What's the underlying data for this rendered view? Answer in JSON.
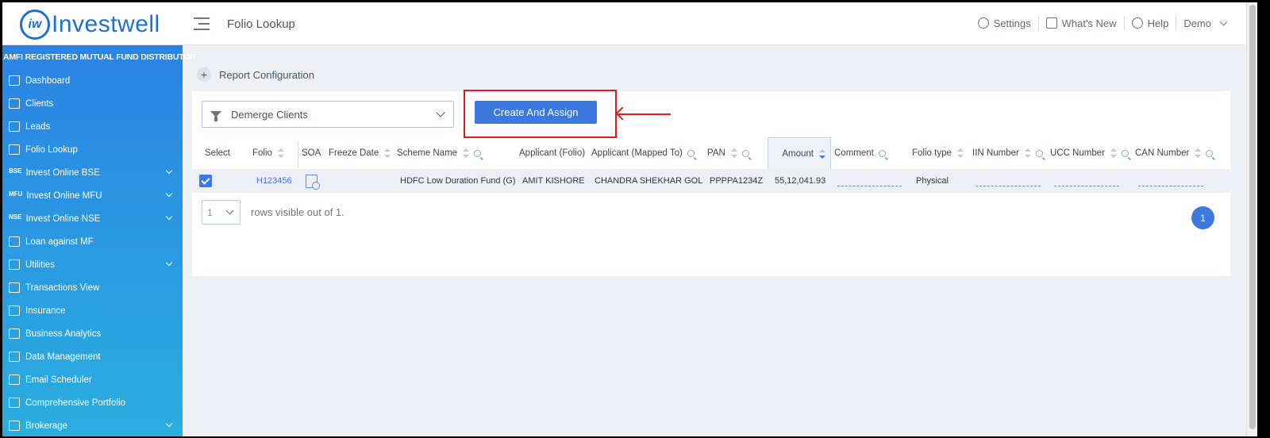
{
  "app": {
    "logo_mark": "iw",
    "logo_text": "Investwell"
  },
  "header": {
    "page_title": "Folio Lookup",
    "settings": "Settings",
    "whats_new": "What's New",
    "help": "Help",
    "user": "Demo"
  },
  "sidebar": {
    "amfi": "AMFI REGISTERED MUTUAL FUND DISTRIBUTOR",
    "items": [
      {
        "label": "Dashboard",
        "icon": "home-icon",
        "chevron": false
      },
      {
        "label": "Clients",
        "icon": "clients-icon",
        "chevron": false
      },
      {
        "label": "Leads",
        "icon": "leads-icon",
        "chevron": false
      },
      {
        "label": "Folio Lookup",
        "icon": "folio-lookup-icon",
        "chevron": false
      },
      {
        "label": "Invest Online BSE",
        "icon": "bse-icon",
        "icon_text": "BSE",
        "chevron": true
      },
      {
        "label": "Invest Online MFU",
        "icon": "mfu-icon",
        "icon_text": "MFU",
        "chevron": true
      },
      {
        "label": "Invest Online NSE",
        "icon": "nse-icon",
        "icon_text": "NSE",
        "chevron": true
      },
      {
        "label": "Loan against MF",
        "icon": "loan-icon",
        "chevron": false
      },
      {
        "label": "Utilities",
        "icon": "utilities-icon",
        "chevron": true
      },
      {
        "label": "Transactions View",
        "icon": "transactions-icon",
        "chevron": false
      },
      {
        "label": "Insurance",
        "icon": "insurance-icon",
        "chevron": false
      },
      {
        "label": "Business Analytics",
        "icon": "analytics-icon",
        "chevron": false
      },
      {
        "label": "Data Management",
        "icon": "data-management-icon",
        "chevron": false
      },
      {
        "label": "Email Scheduler",
        "icon": "email-icon",
        "chevron": false
      },
      {
        "label": "Comprehensive Portfolio",
        "icon": "portfolio-icon",
        "chevron": false
      },
      {
        "label": "Brokerage",
        "icon": "brokerage-icon",
        "chevron": true
      }
    ]
  },
  "main": {
    "report_config": "Report Configuration",
    "dropdown_value": "Demerge Clients",
    "create_button": "Create And Assign",
    "table": {
      "columns": {
        "select": "Select",
        "folio": "Folio",
        "soa": "SOA",
        "freeze_date": "Freeze Date",
        "scheme_name": "Scheme Name",
        "applicant_folio": "Applicant (Folio)",
        "applicant_mapped": "Applicant (Mapped To)",
        "pan": "PAN",
        "amount": "Amount",
        "comment": "Comment",
        "folio_type": "Folio type",
        "iin_number": "IIN Number",
        "ucc_number": "UCC Number",
        "can_number": "CAN Number"
      },
      "row": {
        "folio": "H123456",
        "scheme_name": "HDFC Low Duration Fund (G)",
        "applicant_folio": "AMIT KISHORE",
        "applicant_mapped": "CHANDRA SHEKHAR GOL",
        "pan": "PPPPA1234Z",
        "amount": "55,12,041.93",
        "folio_type": "Physical"
      }
    },
    "pager": {
      "rows_value": "1",
      "rows_text": "rows visible out of 1.",
      "current_page": "1"
    }
  },
  "colors": {
    "accent": "#3d78e0",
    "annotation": "#e8191a"
  }
}
